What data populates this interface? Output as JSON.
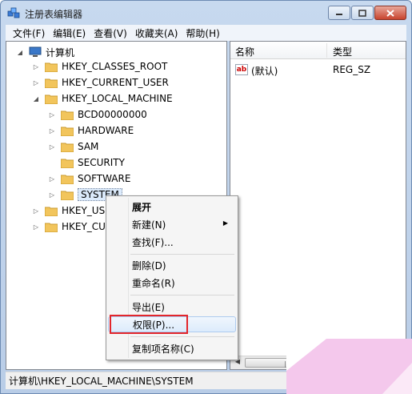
{
  "window": {
    "title": "注册表编辑器",
    "colors": {
      "accent": "#c7d9ef",
      "close": "#c8442e",
      "highlight": "#e3262b"
    }
  },
  "menubar": {
    "items": [
      "文件(F)",
      "编辑(E)",
      "查看(V)",
      "收藏夹(A)",
      "帮助(H)"
    ]
  },
  "tree": {
    "root": "计算机",
    "nodes": [
      {
        "label": "HKEY_CLASSES_ROOT"
      },
      {
        "label": "HKEY_CURRENT_USER"
      },
      {
        "label": "HKEY_LOCAL_MACHINE"
      },
      {
        "label": "BCD00000000"
      },
      {
        "label": "HARDWARE"
      },
      {
        "label": "SAM"
      },
      {
        "label": "SECURITY"
      },
      {
        "label": "SOFTWARE"
      },
      {
        "label": "SYSTEM"
      },
      {
        "label": "HKEY_USE"
      },
      {
        "label": "HKEY_CUR"
      }
    ]
  },
  "list": {
    "headers": {
      "name": "名称",
      "type": "类型"
    },
    "rows": [
      {
        "icon": "string-value-icon",
        "name": "(默认)",
        "type": "REG_SZ"
      }
    ],
    "scroll_grip": "|||"
  },
  "context_menu": {
    "items": {
      "expand": "展开",
      "new": "新建(N)",
      "find": "查找(F)...",
      "delete": "删除(D)",
      "rename": "重命名(R)",
      "export": "导出(E)",
      "permissions": "权限(P)...",
      "copy_key_name": "复制项名称(C)"
    }
  },
  "statusbar": {
    "path": "计算机\\HKEY_LOCAL_MACHINE\\SYSTEM"
  }
}
